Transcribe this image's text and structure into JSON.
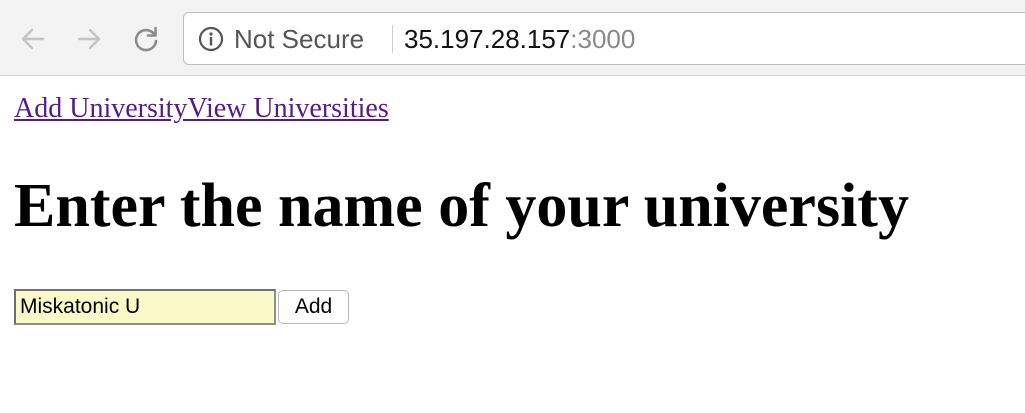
{
  "browser": {
    "security_label": "Not Secure",
    "url_host": "35.197.28.157",
    "url_port": ":3000"
  },
  "nav": {
    "add_university": "Add University",
    "view_universities": "View Universities"
  },
  "main": {
    "title": "Enter the name of your university",
    "input_value": "Miskatonic U",
    "add_button_label": "Add"
  }
}
